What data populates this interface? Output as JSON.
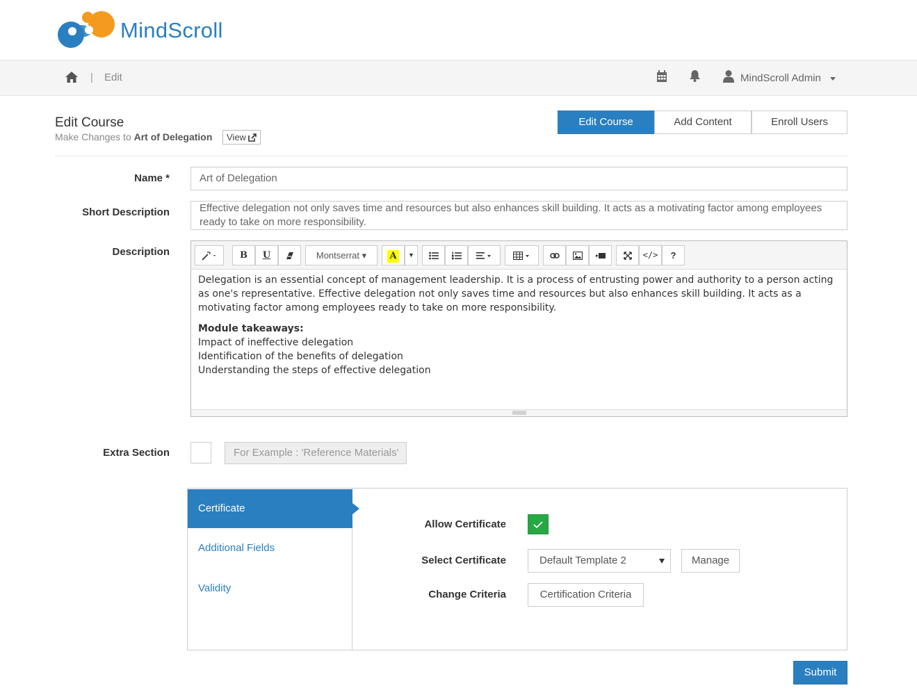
{
  "brand": {
    "name": "MindScroll",
    "colors": {
      "blue": "#2a7fc0",
      "orange": "#f39a1f"
    }
  },
  "nav": {
    "separator": "|",
    "crumb": "Edit",
    "icons": [
      "home-icon",
      "calendar-icon",
      "bell-icon",
      "user-icon"
    ],
    "user_name": "MindScroll Admin"
  },
  "header": {
    "title": "Edit Course",
    "subtitle_prefix": "Make Changes to ",
    "course_name": "Art of Delegation",
    "view_label": "View",
    "tabs": [
      {
        "label": "Edit Course",
        "active": true
      },
      {
        "label": "Add Content",
        "active": false
      },
      {
        "label": "Enroll Users",
        "active": false
      }
    ]
  },
  "form": {
    "name_label": "Name *",
    "name_value": "Art of Delegation",
    "short_desc_label": "Short Description",
    "short_desc_value": "Effective delegation not only saves time and resources but also enhances skill building. It acts as a motivating factor among employees ready to take on more responsibility.",
    "desc_label": "Description",
    "editor": {
      "font_name": "Montserrat",
      "paragraph": "Delegation is an essential concept of management leadership. It is a process of entrusting power and authority to a person acting as one's representative. Effective delegation not only saves time and resources but also enhances skill building. It acts as a motivating factor among employees ready to take on more responsibility.",
      "takeaways_title": "Module takeaways:",
      "takeaways": [
        "Impact of ineffective delegation",
        "Identification of the benefits of delegation",
        "Understanding the steps of effective delegation"
      ],
      "help_label": "?"
    },
    "extra_label": "Extra Section",
    "extra_placeholder": "For Example : 'Reference Materials'"
  },
  "panel": {
    "tabs": [
      {
        "label": "Certificate",
        "active": true
      },
      {
        "label": "Additional Fields",
        "active": false
      },
      {
        "label": "Validity",
        "active": false
      }
    ],
    "allow_label": "Allow Certificate",
    "allow_checked": true,
    "select_label": "Select Certificate",
    "select_value": "Default Template 2",
    "manage_label": "Manage",
    "criteria_label": "Change Criteria",
    "criteria_button": "Certification Criteria"
  },
  "submit_label": "Submit"
}
